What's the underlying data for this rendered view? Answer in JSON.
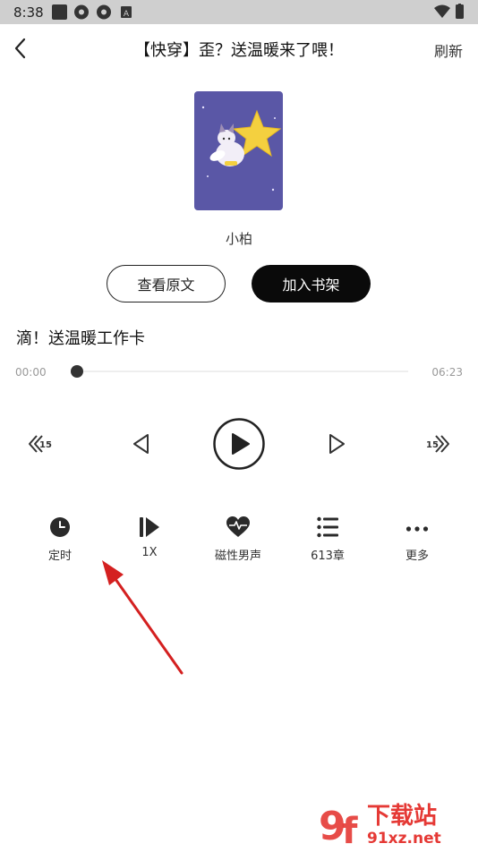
{
  "status": {
    "time": "8:38"
  },
  "header": {
    "title": "【快穿】歪？送温暖来了喂！",
    "refresh": "刷新"
  },
  "book": {
    "author": "小柏"
  },
  "actions": {
    "view_original": "查看原文",
    "add_shelf": "加入书架"
  },
  "player": {
    "chapter_title": "滴！送温暖工作卡",
    "current_time": "00:00",
    "total_time": "06:23",
    "progress": 0.0
  },
  "controls": [
    {
      "name": "rewind-15",
      "icon": "rewind-15-icon"
    },
    {
      "name": "previous",
      "icon": "previous-icon"
    },
    {
      "name": "play",
      "icon": "play-icon"
    },
    {
      "name": "next",
      "icon": "next-icon"
    },
    {
      "name": "forward-15",
      "icon": "forward-15-icon"
    }
  ],
  "functions": {
    "timer": "定时",
    "speed": "1X",
    "voice": "磁性男声",
    "chapters": "613章",
    "more": "更多"
  },
  "watermark": {
    "text": "下载站",
    "url": "91xz.net"
  }
}
